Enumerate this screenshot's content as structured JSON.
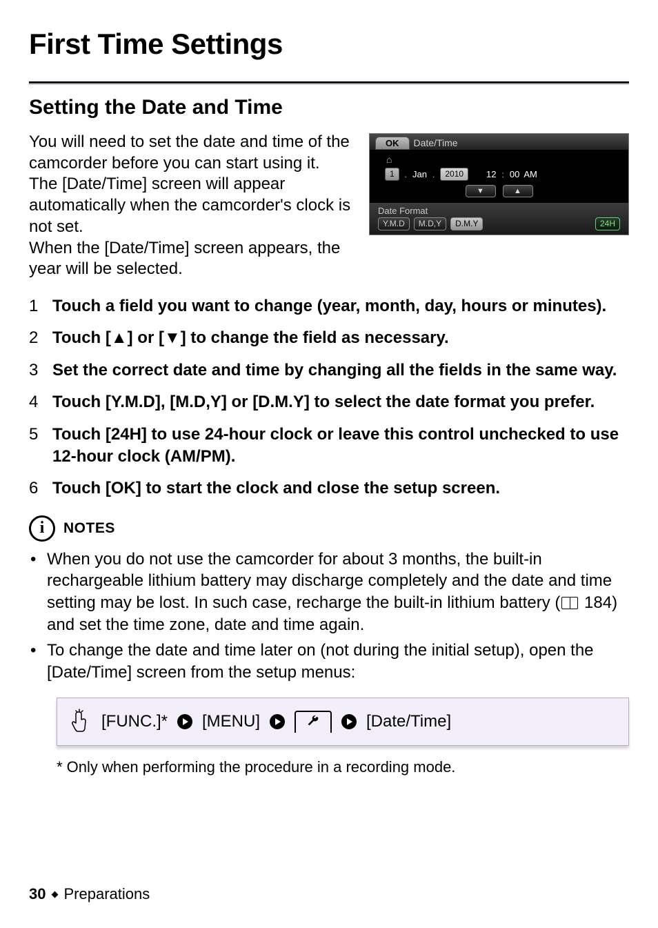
{
  "title": "First Time Settings",
  "section": "Setting the Date and Time",
  "intro": "You will need to set the date and time of the camcorder before you can start using it. The [Date/Time] screen will appear automatically when the camcorder's clock is not set.\nWhen the [Date/Time] screen appears, the year will be selected.",
  "screenshot": {
    "ok": "OK",
    "header": "Date/Time",
    "home": "⌂",
    "day": "1",
    "month": "Jan",
    "year": "2010",
    "hour": "12",
    "min": "00",
    "ampm": "AM",
    "dot": ".",
    "colon": ":",
    "down": "▼",
    "up": "▲",
    "dflabel": "Date Format",
    "df1": "Y.M.D",
    "df2": "M.D,Y",
    "df3": "D.M.Y",
    "h24": "24H"
  },
  "steps": [
    "Touch a field you want to change (year, month, day, hours or minutes).",
    "Touch [▲] or [▼] to change the field as necessary.",
    "Set the correct date and time by changing all the fields in the same way.",
    "Touch [Y.M.D], [M.D,Y] or [D.M.Y] to select the date format you prefer.",
    "Touch [24H] to use 24-hour clock or leave this control unchecked to use 12-hour clock (AM/PM).",
    "Touch [OK] to start the clock and close the setup screen."
  ],
  "notesLabel": "NOTES",
  "notes": {
    "n1a": "When you do not use the camcorder for about 3 months, the built-in rechargeable lithium battery may discharge completely and the date and time setting may be lost. In such case, recharge the built-in lithium battery (",
    "n1page": "184",
    "n1b": ") and set the time zone, date and time again.",
    "n2": "To change the date and time later on (not during the initial setup), open the [Date/Time] screen from the setup menus:"
  },
  "nav": {
    "func": "[FUNC.]*",
    "menu": "[MENU]",
    "datetime": "[Date/Time]"
  },
  "footnote": "* Only when performing the procedure in a recording mode.",
  "footer": {
    "page": "30",
    "section": "Preparations",
    "diamond": "◆"
  }
}
